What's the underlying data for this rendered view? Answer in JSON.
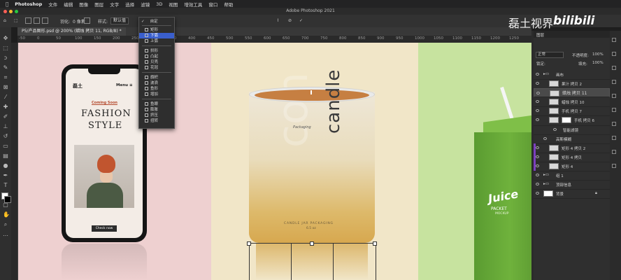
{
  "menubar": {
    "apple": "",
    "app": "Photoshop",
    "items": [
      "文件",
      "编辑",
      "图像",
      "图层",
      "文字",
      "选择",
      "滤镜",
      "3D",
      "视图",
      "增效工具",
      "窗口",
      "帮助"
    ]
  },
  "window_title": "Adobe Photoshop 2021",
  "options": {
    "feather_label": "羽化:",
    "feather_value": "0 像素",
    "style_label": "样式:",
    "style_value": "默认值"
  },
  "document_tab": "P5/产品图形.psd @ 200% (蜡烛 拷贝 11, RGB/8) *",
  "ruler_ticks": [
    "-50",
    "0",
    "50",
    "100",
    "150",
    "200",
    "250",
    "300",
    "350",
    "400",
    "450",
    "500",
    "550",
    "600",
    "650",
    "700",
    "750",
    "800",
    "850",
    "900",
    "950",
    "1000",
    "1050",
    "1100",
    "1150",
    "1200",
    "1250"
  ],
  "dropdown": {
    "items": [
      "自定",
      "矩形",
      "下弧",
      "上弧",
      "拱形",
      "凸起",
      "贝壳",
      "花冠",
      "旗帜",
      "波浪",
      "鱼形",
      "增加",
      "鱼眼",
      "膨胀",
      "挤压",
      "扭转"
    ],
    "checked": "自定",
    "highlighted": "下弧"
  },
  "phone": {
    "brand": "磊土",
    "menu": "Menu ≡",
    "coming_soon": "Coming Soon",
    "headline1": "FASHION",
    "headline2": "STYLE",
    "cta": "Check now"
  },
  "candle": {
    "brand": "candle",
    "script": "Packaging",
    "line1": "CANDLE JAR PACKAGING",
    "line2": "6.5 oz",
    "ghost": "con"
  },
  "juice": {
    "brand": "Juice",
    "packet": "PACKET",
    "mockup": "MOCKUP"
  },
  "watermark": {
    "text": "磊土视界",
    "logo": "bilibili"
  },
  "layers": {
    "mode": "正常",
    "opacity_label": "不透明度:",
    "opacity": "100%",
    "lock_label": "锁定:",
    "fill_label": "填充:",
    "fill": "100%",
    "tab": "图层",
    "rows": [
      {
        "name": "画布"
      },
      {
        "name": "果汁 拷贝 2"
      },
      {
        "name": "蜡烛 拷贝 11"
      },
      {
        "name": "蜡烛 拷贝 10"
      },
      {
        "name": "手机 拷贝 7"
      },
      {
        "name": "手机 拷贝 6"
      },
      {
        "name": "智能滤镜"
      },
      {
        "name": "高斯模糊"
      },
      {
        "name": "矩形 4 拷贝 2"
      },
      {
        "name": "矩形 4 拷贝"
      },
      {
        "name": "矩形 4"
      },
      {
        "name": "组 1"
      },
      {
        "name": "顶部信息"
      },
      {
        "name": "背景"
      }
    ]
  }
}
